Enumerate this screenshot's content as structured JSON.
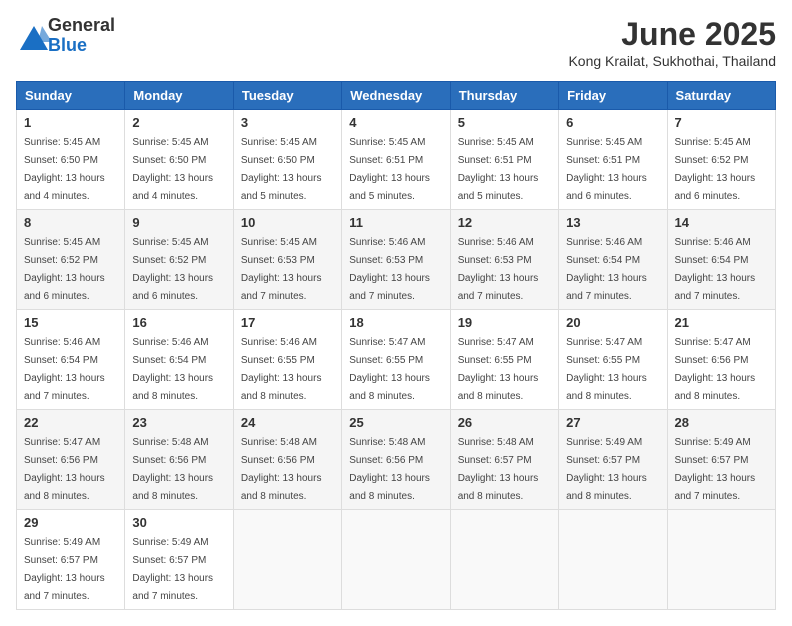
{
  "header": {
    "logo_general": "General",
    "logo_blue": "Blue",
    "month_title": "June 2025",
    "location": "Kong Krailat, Sukhothai, Thailand"
  },
  "calendar": {
    "days_of_week": [
      "Sunday",
      "Monday",
      "Tuesday",
      "Wednesday",
      "Thursday",
      "Friday",
      "Saturday"
    ],
    "weeks": [
      [
        {
          "day": "1",
          "sunrise": "5:45 AM",
          "sunset": "6:50 PM",
          "daylight": "13 hours and 4 minutes."
        },
        {
          "day": "2",
          "sunrise": "5:45 AM",
          "sunset": "6:50 PM",
          "daylight": "13 hours and 4 minutes."
        },
        {
          "day": "3",
          "sunrise": "5:45 AM",
          "sunset": "6:50 PM",
          "daylight": "13 hours and 5 minutes."
        },
        {
          "day": "4",
          "sunrise": "5:45 AM",
          "sunset": "6:51 PM",
          "daylight": "13 hours and 5 minutes."
        },
        {
          "day": "5",
          "sunrise": "5:45 AM",
          "sunset": "6:51 PM",
          "daylight": "13 hours and 5 minutes."
        },
        {
          "day": "6",
          "sunrise": "5:45 AM",
          "sunset": "6:51 PM",
          "daylight": "13 hours and 6 minutes."
        },
        {
          "day": "7",
          "sunrise": "5:45 AM",
          "sunset": "6:52 PM",
          "daylight": "13 hours and 6 minutes."
        }
      ],
      [
        {
          "day": "8",
          "sunrise": "5:45 AM",
          "sunset": "6:52 PM",
          "daylight": "13 hours and 6 minutes."
        },
        {
          "day": "9",
          "sunrise": "5:45 AM",
          "sunset": "6:52 PM",
          "daylight": "13 hours and 6 minutes."
        },
        {
          "day": "10",
          "sunrise": "5:45 AM",
          "sunset": "6:53 PM",
          "daylight": "13 hours and 7 minutes."
        },
        {
          "day": "11",
          "sunrise": "5:46 AM",
          "sunset": "6:53 PM",
          "daylight": "13 hours and 7 minutes."
        },
        {
          "day": "12",
          "sunrise": "5:46 AM",
          "sunset": "6:53 PM",
          "daylight": "13 hours and 7 minutes."
        },
        {
          "day": "13",
          "sunrise": "5:46 AM",
          "sunset": "6:54 PM",
          "daylight": "13 hours and 7 minutes."
        },
        {
          "day": "14",
          "sunrise": "5:46 AM",
          "sunset": "6:54 PM",
          "daylight": "13 hours and 7 minutes."
        }
      ],
      [
        {
          "day": "15",
          "sunrise": "5:46 AM",
          "sunset": "6:54 PM",
          "daylight": "13 hours and 7 minutes."
        },
        {
          "day": "16",
          "sunrise": "5:46 AM",
          "sunset": "6:54 PM",
          "daylight": "13 hours and 8 minutes."
        },
        {
          "day": "17",
          "sunrise": "5:46 AM",
          "sunset": "6:55 PM",
          "daylight": "13 hours and 8 minutes."
        },
        {
          "day": "18",
          "sunrise": "5:47 AM",
          "sunset": "6:55 PM",
          "daylight": "13 hours and 8 minutes."
        },
        {
          "day": "19",
          "sunrise": "5:47 AM",
          "sunset": "6:55 PM",
          "daylight": "13 hours and 8 minutes."
        },
        {
          "day": "20",
          "sunrise": "5:47 AM",
          "sunset": "6:55 PM",
          "daylight": "13 hours and 8 minutes."
        },
        {
          "day": "21",
          "sunrise": "5:47 AM",
          "sunset": "6:56 PM",
          "daylight": "13 hours and 8 minutes."
        }
      ],
      [
        {
          "day": "22",
          "sunrise": "5:47 AM",
          "sunset": "6:56 PM",
          "daylight": "13 hours and 8 minutes."
        },
        {
          "day": "23",
          "sunrise": "5:48 AM",
          "sunset": "6:56 PM",
          "daylight": "13 hours and 8 minutes."
        },
        {
          "day": "24",
          "sunrise": "5:48 AM",
          "sunset": "6:56 PM",
          "daylight": "13 hours and 8 minutes."
        },
        {
          "day": "25",
          "sunrise": "5:48 AM",
          "sunset": "6:56 PM",
          "daylight": "13 hours and 8 minutes."
        },
        {
          "day": "26",
          "sunrise": "5:48 AM",
          "sunset": "6:57 PM",
          "daylight": "13 hours and 8 minutes."
        },
        {
          "day": "27",
          "sunrise": "5:49 AM",
          "sunset": "6:57 PM",
          "daylight": "13 hours and 8 minutes."
        },
        {
          "day": "28",
          "sunrise": "5:49 AM",
          "sunset": "6:57 PM",
          "daylight": "13 hours and 7 minutes."
        }
      ],
      [
        {
          "day": "29",
          "sunrise": "5:49 AM",
          "sunset": "6:57 PM",
          "daylight": "13 hours and 7 minutes."
        },
        {
          "day": "30",
          "sunrise": "5:49 AM",
          "sunset": "6:57 PM",
          "daylight": "13 hours and 7 minutes."
        },
        null,
        null,
        null,
        null,
        null
      ]
    ]
  }
}
